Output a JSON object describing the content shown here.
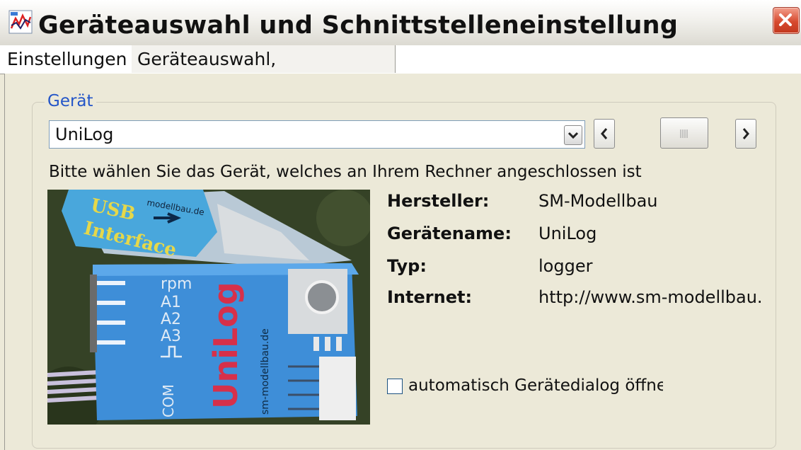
{
  "window": {
    "title": "Geräteauswahl und Schnittstelleneinstellung",
    "icons": {
      "app": "app-chart-icon",
      "close": "close-icon"
    }
  },
  "tabs": [
    {
      "label": "Einstellungen",
      "active": true
    },
    {
      "label": "Geräteauswahl, Portübersicht",
      "active": false
    }
  ],
  "device_group": {
    "label": "Gerät",
    "selected_device": "UniLog",
    "hint": "Bitte wählen Sie das Gerät, welches an Ihrem Rechner angeschlossen ist",
    "photo": {
      "usb_text_1": "USB",
      "usb_text_2": "Interface",
      "usb_url": "modellbau.de",
      "labels": [
        "rpm",
        "A1",
        "A2",
        "A3"
      ],
      "com_label": "COM",
      "brand": "UniLog",
      "url": "sm-modellbau.de"
    },
    "info": {
      "manufacturer_label": "Hersteller:",
      "manufacturer_value": "SM-Modellbau",
      "device_name_label": "Gerätename:",
      "device_name_value": "UniLog",
      "type_label": "Typ:",
      "type_value": "logger",
      "internet_label": "Internet:",
      "internet_value": "http://www.sm-modellbau.de"
    },
    "auto_open_label": "automatisch Gerätedialog öffnen",
    "auto_open_checked": false
  },
  "colors": {
    "accent": "#2355c8",
    "window_bg": "#ece9d8",
    "close_red": "#d74a2f"
  }
}
